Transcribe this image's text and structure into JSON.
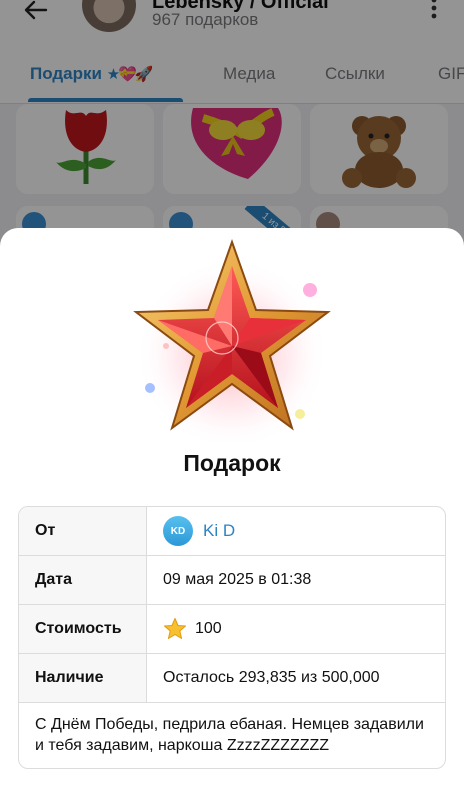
{
  "background": {
    "channel_name": "Lebensky / Official",
    "channel_sub": "967 подарков",
    "tabs": [
      {
        "label": "Подарки",
        "emoji": "★💝🚀"
      },
      {
        "label": "Медиа"
      },
      {
        "label": "Ссылки"
      },
      {
        "label": "GIF"
      }
    ],
    "ribbon": "1 из 5"
  },
  "sheet": {
    "title": "Подарок",
    "rows": {
      "from_label": "От",
      "from_initials": "KD",
      "from_name": "Ki D",
      "date_label": "Дата",
      "date_value": "09 мая 2025 в 01:38",
      "cost_label": "Стоимость",
      "cost_value": "100",
      "availability_label": "Наличие",
      "availability_value": "Осталось 293,835 из 500,000"
    },
    "message": "С Днём Победы, педрила ебаная. Немцев задавили и тебя задавим, наркоша ZzzzZZZZZZZ"
  },
  "colors": {
    "accent": "#2f86c5",
    "link": "#2d84c3",
    "star_red": "#d8262f",
    "star_gold": "#e7a93b"
  }
}
